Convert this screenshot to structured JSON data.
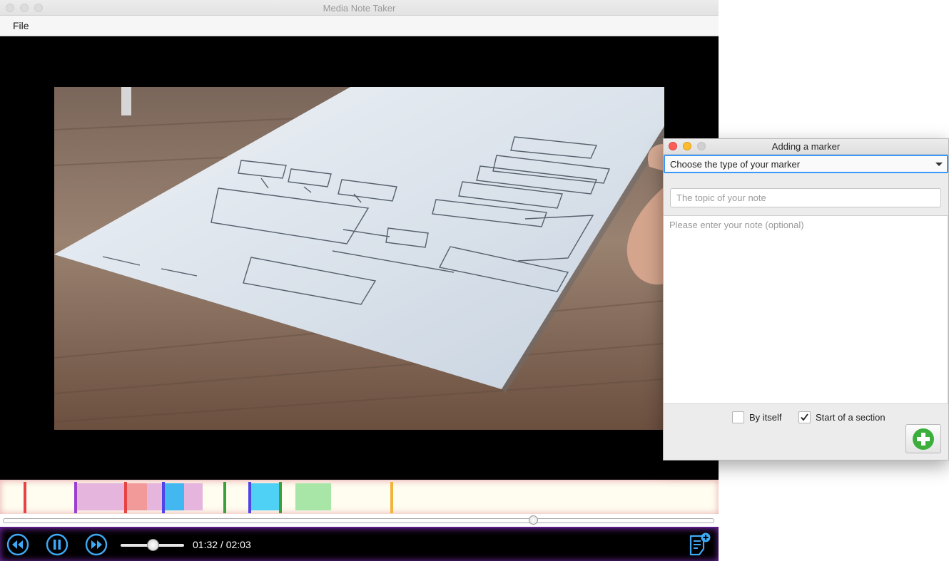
{
  "main_window": {
    "title": "Media Note Taker",
    "menu": {
      "file_label": "File"
    }
  },
  "timeline": {
    "segments": [
      {
        "color": "#e5b5de"
      },
      {
        "color": "#f29a9a"
      },
      {
        "color": "#e5b5de"
      },
      {
        "color": "#43b7f0"
      },
      {
        "color": "#e5b5de"
      },
      {
        "color": "#4ed1f4"
      },
      {
        "color": "#a7e6a7"
      }
    ],
    "markers": [
      {
        "color": "#e84343"
      },
      {
        "color": "#9b3fd0"
      },
      {
        "color": "#e84343"
      },
      {
        "color": "#4f44e8"
      },
      {
        "color": "#3aa03a"
      },
      {
        "color": "#4f44e8"
      },
      {
        "color": "#3aa03a"
      },
      {
        "color": "#f3b23a"
      }
    ]
  },
  "playback": {
    "position_fraction": 0.745,
    "volume_fraction": 0.5,
    "time_text": "01:32 / 02:03"
  },
  "colors": {
    "accent": "#3ea9f5",
    "controls_glow": "#7b2bb0",
    "focus_ring": "#3b99fc",
    "add_icon": "#3cae3c"
  },
  "icons": {
    "rewind": "rewind-icon",
    "pause": "pause-icon",
    "forward": "fast-forward-icon",
    "add_note": "add-note-icon",
    "add_marker": "plus-circle-icon"
  },
  "dialog": {
    "title": "Adding a marker",
    "type_select_label": "Choose the type of your marker",
    "topic_placeholder": "The topic of your note",
    "note_placeholder": "Please enter your note (optional)",
    "checkbox_by_itself": {
      "label": "By itself",
      "checked": false
    },
    "checkbox_start_section": {
      "label": "Start of a section",
      "checked": true
    }
  }
}
